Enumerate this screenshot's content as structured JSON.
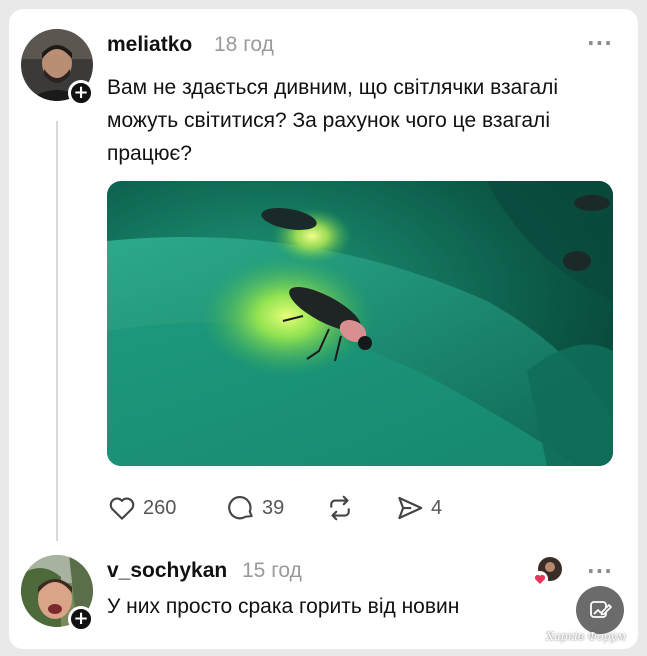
{
  "post": {
    "username": "meliatko",
    "time": "18 год",
    "more_icon": "more-horizontal-icon",
    "text": "Вам не здається дивним, що світлячки взагалі можуть світитися? За рахунок чого це взагалі працює?",
    "image_alt": "firefly glowing on a green leaf",
    "actions": {
      "likes": "260",
      "comments": "39",
      "reposts": "",
      "shares": "4"
    }
  },
  "reply": {
    "username": "v_sochykan",
    "time": "15 год",
    "text": "У них просто срака горить від новин",
    "liked_by_author": true
  },
  "watermark": "Харків Форум",
  "colors": {
    "text": "#111111",
    "muted": "#9a9a9a",
    "like_badge": "#e8365d",
    "fab": "#6b6b6b"
  }
}
